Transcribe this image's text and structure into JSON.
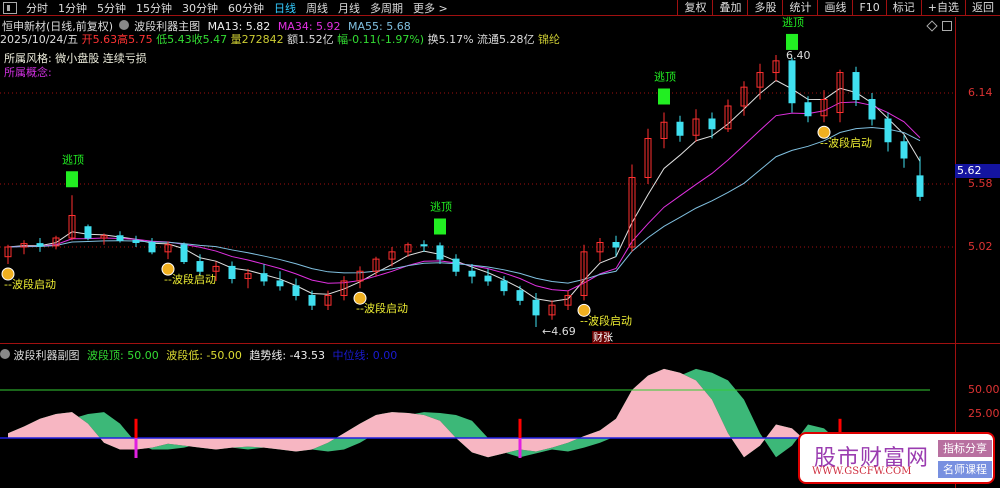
{
  "toolbar": {
    "periods": [
      "分时",
      "1分钟",
      "5分钟",
      "15分钟",
      "30分钟",
      "60分钟",
      "日线",
      "周线",
      "月线",
      "多周期",
      "更多 >"
    ],
    "active": "日线",
    "right_buttons": [
      "复权",
      "叠加",
      "多股",
      "统计",
      "画线",
      "F10",
      "标记",
      "+自选",
      "返回"
    ]
  },
  "header": {
    "title": "恒申新材(日线,前复权)",
    "indicator": "波段利器主图",
    "ma13": "MA13: 5.82",
    "ma34": "MA34: 5.92",
    "ma55": "MA55: 5.68",
    "date": "2025/10/24/五",
    "open": "开5.63",
    "high": "高5.75",
    "low": "低5.43",
    "close": "收5.47",
    "volume": "量272842",
    "amount": "额1.52亿",
    "change": "幅-0.11(-1.97%)",
    "turnover": "换5.17%",
    "float": "流通5.28亿",
    "extra": "锦纶",
    "style_label": "所属风格:",
    "style_value": "微小盘股 连续亏损",
    "concept_label": "所属概念:"
  },
  "axis": {
    "ticks": [
      {
        "label": "6.14",
        "price": 6.14
      },
      {
        "label": "5.58",
        "price": 5.58
      },
      {
        "label": "5.02",
        "price": 5.02
      }
    ],
    "current": "5.62",
    "sub_ticks": [
      {
        "label": "50.00",
        "value": 50
      },
      {
        "label": "25.00",
        "value": 25
      }
    ]
  },
  "annotations": {
    "high_label": "6.40",
    "low_label": "4.69",
    "buy": "--波段启动",
    "top": "逃顶",
    "badge": "财",
    "badge2": "张"
  },
  "signals": {
    "buy": [
      0,
      10,
      22,
      36,
      51
    ],
    "top": [
      4,
      27,
      41,
      49
    ]
  },
  "colors": {
    "up": "#ff3030",
    "down": "#40e0f0",
    "ma13": "#e0e0e0",
    "ma34": "#e030e0",
    "ma55": "#80c0e0",
    "pink": "#f7b6c2",
    "green": "#3cb878"
  },
  "candles": [
    [
      4.98,
      5.04,
      4.95,
      5.02
    ],
    [
      5.02,
      5.08,
      4.99,
      5.05
    ],
    [
      5.05,
      5.1,
      5.0,
      5.03
    ],
    [
      5.03,
      5.12,
      5.01,
      5.1
    ],
    [
      5.1,
      5.48,
      5.08,
      5.3
    ],
    [
      5.2,
      5.22,
      5.08,
      5.1
    ],
    [
      5.1,
      5.14,
      5.04,
      5.12
    ],
    [
      5.12,
      5.16,
      5.06,
      5.08
    ],
    [
      5.08,
      5.12,
      5.02,
      5.06
    ],
    [
      5.06,
      5.1,
      4.99,
      5.0
    ],
    [
      5.0,
      5.07,
      4.97,
      5.04
    ],
    [
      5.04,
      5.06,
      4.95,
      4.96
    ],
    [
      4.96,
      4.99,
      4.9,
      4.92
    ],
    [
      4.92,
      4.96,
      4.88,
      4.94
    ],
    [
      4.94,
      4.96,
      4.87,
      4.89
    ],
    [
      4.89,
      4.93,
      4.85,
      4.91
    ],
    [
      4.91,
      4.95,
      4.86,
      4.88
    ],
    [
      4.88,
      4.92,
      4.84,
      4.86
    ],
    [
      4.86,
      4.89,
      4.8,
      4.82
    ],
    [
      4.82,
      4.84,
      4.76,
      4.78
    ],
    [
      4.78,
      4.84,
      4.76,
      4.82
    ],
    [
      4.82,
      4.9,
      4.8,
      4.88
    ],
    [
      4.88,
      4.94,
      4.85,
      4.92
    ],
    [
      4.92,
      4.98,
      4.9,
      4.97
    ],
    [
      4.97,
      5.02,
      4.94,
      5.0
    ],
    [
      5.0,
      5.06,
      4.98,
      5.04
    ],
    [
      5.04,
      5.08,
      5.0,
      5.03
    ],
    [
      5.03,
      5.06,
      4.95,
      4.97
    ],
    [
      4.97,
      4.99,
      4.9,
      4.92
    ],
    [
      4.92,
      4.95,
      4.87,
      4.9
    ],
    [
      4.9,
      4.93,
      4.86,
      4.88
    ],
    [
      4.88,
      4.9,
      4.82,
      4.84
    ],
    [
      4.84,
      4.86,
      4.78,
      4.8
    ],
    [
      4.8,
      4.83,
      4.69,
      4.74
    ],
    [
      4.74,
      4.8,
      4.72,
      4.78
    ],
    [
      4.78,
      4.84,
      4.76,
      4.82
    ],
    [
      4.82,
      5.04,
      4.8,
      5.0
    ],
    [
      5.0,
      5.1,
      4.96,
      5.06
    ],
    [
      5.06,
      5.12,
      4.98,
      5.02
    ],
    [
      5.02,
      5.7,
      5.0,
      5.62
    ],
    [
      5.62,
      5.92,
      5.58,
      5.86
    ],
    [
      5.86,
      6.02,
      5.8,
      5.96
    ],
    [
      5.96,
      6.0,
      5.84,
      5.88
    ],
    [
      5.88,
      6.04,
      5.84,
      5.98
    ],
    [
      5.98,
      6.02,
      5.86,
      5.92
    ],
    [
      5.92,
      6.1,
      5.9,
      6.06
    ],
    [
      6.06,
      6.22,
      6.0,
      6.18
    ],
    [
      6.18,
      6.34,
      6.1,
      6.28
    ],
    [
      6.28,
      6.4,
      6.22,
      6.36
    ],
    [
      6.36,
      6.38,
      6.02,
      6.08
    ],
    [
      6.08,
      6.12,
      5.96,
      6.0
    ],
    [
      6.0,
      6.16,
      5.96,
      6.1
    ],
    [
      6.02,
      6.3,
      5.96,
      6.28
    ],
    [
      6.28,
      6.32,
      6.06,
      6.1
    ],
    [
      6.1,
      6.14,
      5.94,
      5.98
    ],
    [
      5.98,
      6.02,
      5.78,
      5.84
    ],
    [
      5.84,
      5.88,
      5.68,
      5.74
    ],
    [
      5.63,
      5.75,
      5.43,
      5.47
    ]
  ],
  "sub": {
    "title": "波段利器副图",
    "top_label": "波段顶: 50.00",
    "low_label": "波段低: -50.00",
    "trend_label": "趋势线: -43.53",
    "mid_label": "中位线: 0.00",
    "wave": [
      5,
      12,
      20,
      25,
      27,
      15,
      -5,
      -12,
      -12,
      -10,
      -6,
      -8,
      -10,
      -12,
      -10,
      -9,
      -10,
      -12,
      -14,
      -12,
      -5,
      5,
      15,
      24,
      27,
      26,
      24,
      18,
      0,
      -15,
      -20,
      -16,
      -12,
      -14,
      -10,
      -5,
      2,
      8,
      20,
      50,
      65,
      72,
      68,
      60,
      40,
      5,
      -20,
      -8,
      14,
      10,
      -5,
      -15,
      -10,
      0,
      -5,
      -10,
      -15,
      -20
    ],
    "red_bars": [
      8,
      32,
      52
    ]
  },
  "watermark": {
    "name": "股市财富网",
    "url": "WWW.GSCFW.COM",
    "btn1": "指标分享",
    "btn2": "名师课程"
  }
}
